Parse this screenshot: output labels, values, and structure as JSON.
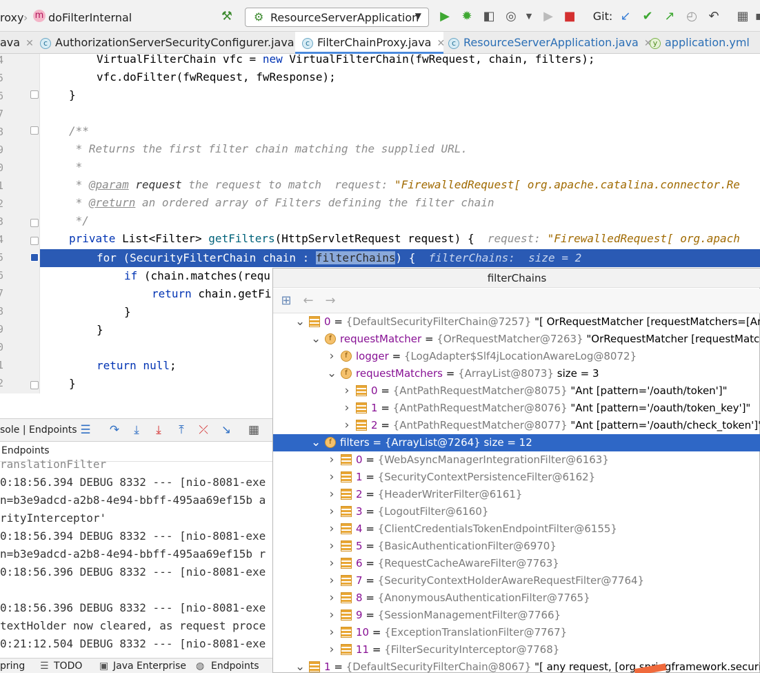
{
  "breadcrumb": {
    "class_part": "roxy",
    "method_badge": "m",
    "method": "doFilterInternal"
  },
  "toolbar": {
    "run_config": "ResourceServerApplication",
    "git_label": "Git:"
  },
  "tabs": [
    {
      "label": "ava",
      "active": false
    },
    {
      "label": "AuthorizationServerSecurityConfigurer.java",
      "active": false
    },
    {
      "label": "FilterChainProxy.java",
      "active": true
    },
    {
      "label": "ResourceServerApplication.java",
      "active": false
    },
    {
      "label": "application.yml",
      "active": false
    }
  ],
  "line_numbers": [
    "4",
    "5",
    "6",
    "7",
    "8",
    "9",
    "0",
    "1",
    "2",
    "3",
    "4",
    "5",
    "6",
    "7",
    "8",
    "9",
    "0",
    "1",
    "2"
  ],
  "code": {
    "l1": "VirtualFilterChain vfc = ",
    "l1_new": "new",
    "l1_rest": " VirtualFilterChain(fwRequest, chain, filters);",
    "l2": "vfc.doFilter(fwRequest, fwResponse);",
    "l3": "}",
    "l5": "/**",
    "l6": " * Returns the first filter chain matching the supplied URL.",
    "l7": " *",
    "l8_a": " * ",
    "l8_tag": "@param",
    "l8_b": " request",
    "l8_c": " the request to match  ",
    "l8_hint": "request: ",
    "l8_str": "\"FirewalledRequest[ org.apache.catalina.connector.Re",
    "l9_a": " * ",
    "l9_tag": "@return",
    "l9_b": " an ordered array of Filters defining the filter chain",
    "l10": " */",
    "l11_kw": "private",
    "l11_a": " List<Filter> ",
    "l11_m": "getFilters",
    "l11_b": "(HttpServletRequest request) {  ",
    "l11_hint": "request: ",
    "l11_str": "\"FirewalledRequest[ org.apach",
    "l12_kw": "for",
    "l12_a": " (SecurityFilterChain chain : ",
    "l12_sel": "filterChains",
    "l12_b": ") {  ",
    "l12_hint": "filterChains:  size = 2",
    "l13_kw": "if",
    "l13_a": " (chain.matches(requ",
    "l14_kw": "return",
    "l14_a": " chain.getFi",
    "l15": "}",
    "l16": "}",
    "l18_kw": "return",
    "l18_b": " null",
    "l18_c": ";",
    "l19": "}"
  },
  "debug": {
    "toolbar_label": "sole | Endpoints",
    "endpoints_label": "Endpoints",
    "log": [
      "ranslationFilter",
      "0:18:56.394 DEBUG 8332 --- [nio-8081-exe",
      "n=b3e9adcd-a2b8-4e94-bbff-495aa69ef15b a",
      "rityInterceptor'",
      "0:18:56.394 DEBUG 8332 --- [nio-8081-exe",
      "n=b3e9adcd-a2b8-4e94-bbff-495aa69ef15b r",
      "0:18:56.396 DEBUG 8332 --- [nio-8081-exe",
      "",
      "0:18:56.396 DEBUG 8332 --- [nio-8081-exe",
      "textHolder now cleared, as request proce",
      "0:21:12.504 DEBUG 8332 --- [nio-8081-exe"
    ]
  },
  "bottom_tabs": [
    "pring",
    "TODO",
    "Java Enterprise",
    "Endpoints"
  ],
  "popup": {
    "title": "filterChains",
    "rows": [
      {
        "chev": "down",
        "icon": "list",
        "name": "0",
        "value": "{DefaultSecurityFilterChain@7257}",
        "extra": " \"[ OrRequestMatcher [requestMatchers=[Ant [p",
        "sel": false,
        "indent": 0
      },
      {
        "chev": "down",
        "icon": "field",
        "name": "requestMatcher",
        "value": "{OrRequestMatcher@7263}",
        "extra": " \"OrRequestMatcher [requestMatcher",
        "sel": false,
        "indent": 1
      },
      {
        "chev": "right",
        "icon": "field",
        "name": "logger",
        "value": "{LogAdapter$Slf4jLocationAwareLog@8072}",
        "extra": "",
        "sel": false,
        "indent": 2
      },
      {
        "chev": "down",
        "icon": "field",
        "name": "requestMatchers",
        "value": "{ArrayList@8073}",
        "extra": "  size = 3",
        "sel": false,
        "indent": 2
      },
      {
        "chev": "right",
        "icon": "list",
        "name": "0",
        "value": "{AntPathRequestMatcher@8075}",
        "extra": " \"Ant [pattern='/oauth/token']\"",
        "sel": false,
        "indent": 3
      },
      {
        "chev": "right",
        "icon": "list",
        "name": "1",
        "value": "{AntPathRequestMatcher@8076}",
        "extra": " \"Ant [pattern='/oauth/token_key']\"",
        "sel": false,
        "indent": 3
      },
      {
        "chev": "right",
        "icon": "list",
        "name": "2",
        "value": "{AntPathRequestMatcher@8077}",
        "extra": " \"Ant [pattern='/oauth/check_token']\"",
        "sel": false,
        "indent": 3
      },
      {
        "chev": "down",
        "icon": "field",
        "name": "filters",
        "value": "{ArrayList@7264}",
        "extra": "  size = 12",
        "sel": true,
        "indent": 1
      },
      {
        "chev": "right",
        "icon": "list",
        "name": "0",
        "value": "{WebAsyncManagerIntegrationFilter@6163}",
        "extra": "",
        "sel": false,
        "indent": 2
      },
      {
        "chev": "right",
        "icon": "list",
        "name": "1",
        "value": "{SecurityContextPersistenceFilter@6162}",
        "extra": "",
        "sel": false,
        "indent": 2
      },
      {
        "chev": "right",
        "icon": "list",
        "name": "2",
        "value": "{HeaderWriterFilter@6161}",
        "extra": "",
        "sel": false,
        "indent": 2
      },
      {
        "chev": "right",
        "icon": "list",
        "name": "3",
        "value": "{LogoutFilter@6160}",
        "extra": "",
        "sel": false,
        "indent": 2
      },
      {
        "chev": "right",
        "icon": "list",
        "name": "4",
        "value": "{ClientCredentialsTokenEndpointFilter@6155}",
        "extra": "",
        "sel": false,
        "indent": 2
      },
      {
        "chev": "right",
        "icon": "list",
        "name": "5",
        "value": "{BasicAuthenticationFilter@6970}",
        "extra": "",
        "sel": false,
        "indent": 2
      },
      {
        "chev": "right",
        "icon": "list",
        "name": "6",
        "value": "{RequestCacheAwareFilter@7763}",
        "extra": "",
        "sel": false,
        "indent": 2
      },
      {
        "chev": "right",
        "icon": "list",
        "name": "7",
        "value": "{SecurityContextHolderAwareRequestFilter@7764}",
        "extra": "",
        "sel": false,
        "indent": 2
      },
      {
        "chev": "right",
        "icon": "list",
        "name": "8",
        "value": "{AnonymousAuthenticationFilter@7765}",
        "extra": "",
        "sel": false,
        "indent": 2
      },
      {
        "chev": "right",
        "icon": "list",
        "name": "9",
        "value": "{SessionManagementFilter@7766}",
        "extra": "",
        "sel": false,
        "indent": 2
      },
      {
        "chev": "right",
        "icon": "list",
        "name": "10",
        "value": "{ExceptionTranslationFilter@7767}",
        "extra": "",
        "sel": false,
        "indent": 2
      },
      {
        "chev": "right",
        "icon": "list",
        "name": "11",
        "value": "{FilterSecurityInterceptor@7768}",
        "extra": "",
        "sel": false,
        "indent": 2
      },
      {
        "chev": "down",
        "icon": "list",
        "name": "1",
        "value": "{DefaultSecurityFilterChain@8067}",
        "extra": " \"[ any request, [org.springframework.security.we",
        "sel": false,
        "indent": 0
      }
    ]
  },
  "colors": {
    "selection": "#2e67c6",
    "keyword": "#0033b3",
    "hint_string": "#a06a00"
  }
}
